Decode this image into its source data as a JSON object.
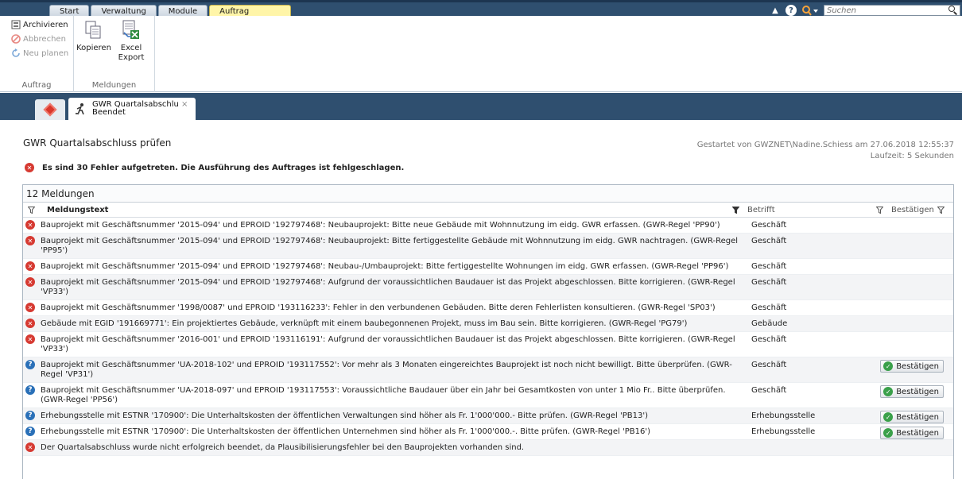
{
  "ribbon_tabs": [
    "Start",
    "Verwaltung",
    "Module",
    "Auftrag"
  ],
  "search": {
    "placeholder": "Suchen"
  },
  "ribbon": {
    "auftrag_group": {
      "label": "Auftrag",
      "archivieren": "Archivieren",
      "abbrechen": "Abbrechen",
      "neu_planen": "Neu planen"
    },
    "meldungen_group": {
      "label": "Meldungen",
      "kopieren": "Kopieren",
      "excel_export_line1": "Excel",
      "excel_export_line2": "Export"
    }
  },
  "doc_tab": {
    "title": "GWR Quartalsabschlu",
    "status": "Beendet",
    "close": "×"
  },
  "job": {
    "title": "GWR Quartalsabschluss prüfen",
    "started_by": "Gestartet von GWZNET\\Nadine.Schiess am 27.06.2018 12:55:37",
    "runtime": "Laufzeit: 5 Sekunden",
    "error_summary": "Es sind 30 Fehler aufgetreten. Die Ausführung des Auftrages ist fehlgeschlagen."
  },
  "grid": {
    "header": "12 Meldungen",
    "columns": {
      "text": "Meldungstext",
      "betrifft": "Betrifft",
      "confirm": "Bestätigen"
    },
    "rows": [
      {
        "type": "error",
        "text": "Bauprojekt mit Geschäftsnummer '2015-094' und EPROID '192797468': Neubauprojekt: Bitte neue Gebäude mit Wohnnutzung im eidg. GWR erfassen. (GWR-Regel 'PP90')",
        "betrifft": "Geschäft",
        "confirm": ""
      },
      {
        "type": "error",
        "text": "Bauprojekt mit Geschäftsnummer '2015-094' und EPROID '192797468': Neubauprojekt: Bitte fertiggestellte Gebäude mit Wohnnutzung im eidg. GWR nachtragen. (GWR-Regel 'PP95')",
        "betrifft": "Geschäft",
        "confirm": ""
      },
      {
        "type": "error",
        "text": "Bauprojekt mit Geschäftsnummer '2015-094' und EPROID '192797468': Neubau-/Umbauprojekt: Bitte fertiggestellte Wohnungen im eidg. GWR erfassen. (GWR-Regel 'PP96')",
        "betrifft": "Geschäft",
        "confirm": ""
      },
      {
        "type": "error",
        "text": "Bauprojekt mit Geschäftsnummer '2015-094' und EPROID '192797468': Aufgrund der voraussichtlichen Baudauer ist das Projekt abgeschlossen. Bitte korrigieren. (GWR-Regel 'VP33')",
        "betrifft": "Geschäft",
        "confirm": ""
      },
      {
        "type": "error",
        "text": "Bauprojekt mit Geschäftsnummer '1998/0087' und EPROID '193116233': Fehler in den verbundenen Gebäuden. Bitte deren Fehlerlisten konsultieren. (GWR-Regel 'SP03')",
        "betrifft": "Geschäft",
        "confirm": ""
      },
      {
        "type": "error",
        "text": "Gebäude mit EGID '191669771': Ein projektiertes Gebäude, verknüpft mit einem baubegonnenen Projekt, muss im Bau sein. Bitte korrigieren. (GWR-Regel 'PG79')",
        "betrifft": "Gebäude",
        "confirm": ""
      },
      {
        "type": "error",
        "text": "Bauprojekt mit Geschäftsnummer '2016-001' und EPROID '193116191': Aufgrund der voraussichtlichen Baudauer ist das Projekt abgeschlossen. Bitte korrigieren. (GWR-Regel 'VP33')",
        "betrifft": "Geschäft",
        "confirm": ""
      },
      {
        "type": "question",
        "text": "Bauprojekt mit Geschäftsnummer 'UA-2018-102' und EPROID '193117552': Vor mehr als 3 Monaten eingereichtes Bauprojekt ist noch nicht bewilligt. Bitte überprüfen. (GWR-Regel 'VP31')",
        "betrifft": "Geschäft",
        "confirm": "Bestätigen"
      },
      {
        "type": "question",
        "text": "Bauprojekt mit Geschäftsnummer 'UA-2018-097' und EPROID '193117553': Voraussichtliche Baudauer über ein Jahr bei Gesamtkosten von unter 1 Mio Fr.. Bitte überprüfen. (GWR-Regel 'PP56')",
        "betrifft": "Geschäft",
        "confirm": "Bestätigen"
      },
      {
        "type": "question",
        "text": "Erhebungsstelle mit ESTNR '170900': Die Unterhaltskosten der öffentlichen Verwaltungen sind höher als Fr. 1'000'000.- Bitte prüfen. (GWR-Regel 'PB13')",
        "betrifft": "Erhebungsstelle",
        "confirm": "Bestätigen"
      },
      {
        "type": "question",
        "text": "Erhebungsstelle mit ESTNR '170900': Die Unterhaltskosten der öffentlichen Unternehmen sind höher als Fr. 1'000'000.-. Bitte prüfen. (GWR-Regel 'PB16')",
        "betrifft": "Erhebungsstelle",
        "confirm": "Bestätigen"
      },
      {
        "type": "error",
        "text": "Der Quartalsabschluss wurde nicht erfolgreich beendet, da Plausibilisierungsfehler bei den Bauprojekten vorhanden sind.",
        "betrifft": "",
        "confirm": ""
      }
    ]
  },
  "colors": {
    "topbar": "#2f4f6f",
    "active_tab": "#fff5a8",
    "error": "#d63a32",
    "question": "#2a70b8",
    "ok": "#3aa04a"
  }
}
